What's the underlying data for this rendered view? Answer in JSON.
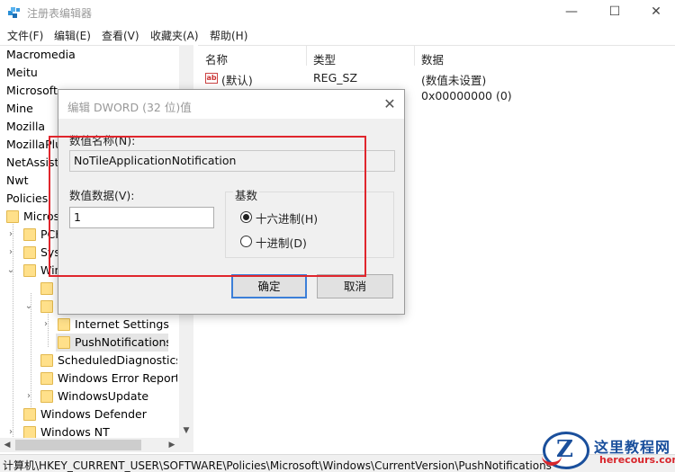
{
  "window": {
    "title": "注册表编辑器",
    "controls": {
      "minimize": "—",
      "maximize": "☐",
      "close": "✕"
    }
  },
  "menu": [
    "文件(F)",
    "编辑(E)",
    "查看(V)",
    "收藏夹(A)",
    "帮助(H)"
  ],
  "tree": {
    "items": [
      {
        "label": "Macromedia"
      },
      {
        "label": "Meitu"
      },
      {
        "label": "Microsoft"
      },
      {
        "label": "Mine"
      },
      {
        "label": "Mozilla"
      },
      {
        "label": "MozillaPlu"
      },
      {
        "label": "NetAssista"
      },
      {
        "label": "Nwt"
      },
      {
        "label": "Policies"
      },
      {
        "label": "Micros"
      },
      {
        "label": "PCH"
      },
      {
        "label": "Sys"
      },
      {
        "label": "Win"
      },
      {
        "label": "Internet Settings"
      },
      {
        "label": "PushNotifications"
      },
      {
        "label": "ScheduledDiagnostics"
      },
      {
        "label": "Windows Error Reporti"
      },
      {
        "label": "WindowsUpdate"
      },
      {
        "label": "Windows Defender"
      },
      {
        "label": "Windows NT"
      }
    ]
  },
  "list": {
    "columns": [
      "名称",
      "类型",
      "数据"
    ],
    "rows": [
      {
        "name": "(默认)",
        "type": "REG_SZ",
        "data": "(数值未设置)"
      },
      {
        "name": "",
        "type": "",
        "data": "0x00000000 (0)"
      }
    ]
  },
  "statusbar": {
    "path": "计算机\\HKEY_CURRENT_USER\\SOFTWARE\\Policies\\Microsoft\\Windows\\CurrentVersion\\PushNotifications"
  },
  "dialog": {
    "title": "编辑 DWORD (32 位)值",
    "name_label": "数值名称(N):",
    "name_value": "NoTileApplicationNotification",
    "data_label": "数值数据(V):",
    "data_value": "1",
    "base_title": "基数",
    "base_options": [
      {
        "label": "十六进制(H)",
        "selected": true
      },
      {
        "label": "十进制(D)",
        "selected": false
      }
    ],
    "ok_label": "确定",
    "cancel_label": "取消",
    "close_glyph": "✕"
  },
  "watermark": {
    "logo_letter": "Z",
    "name": "这里教程网",
    "url": "herecours.com"
  },
  "colors": {
    "highlight": "#e0262d",
    "default_button_border": "#3c7fd8",
    "watermark_blue": "#1a4f9c",
    "watermark_red": "#d8262c"
  }
}
